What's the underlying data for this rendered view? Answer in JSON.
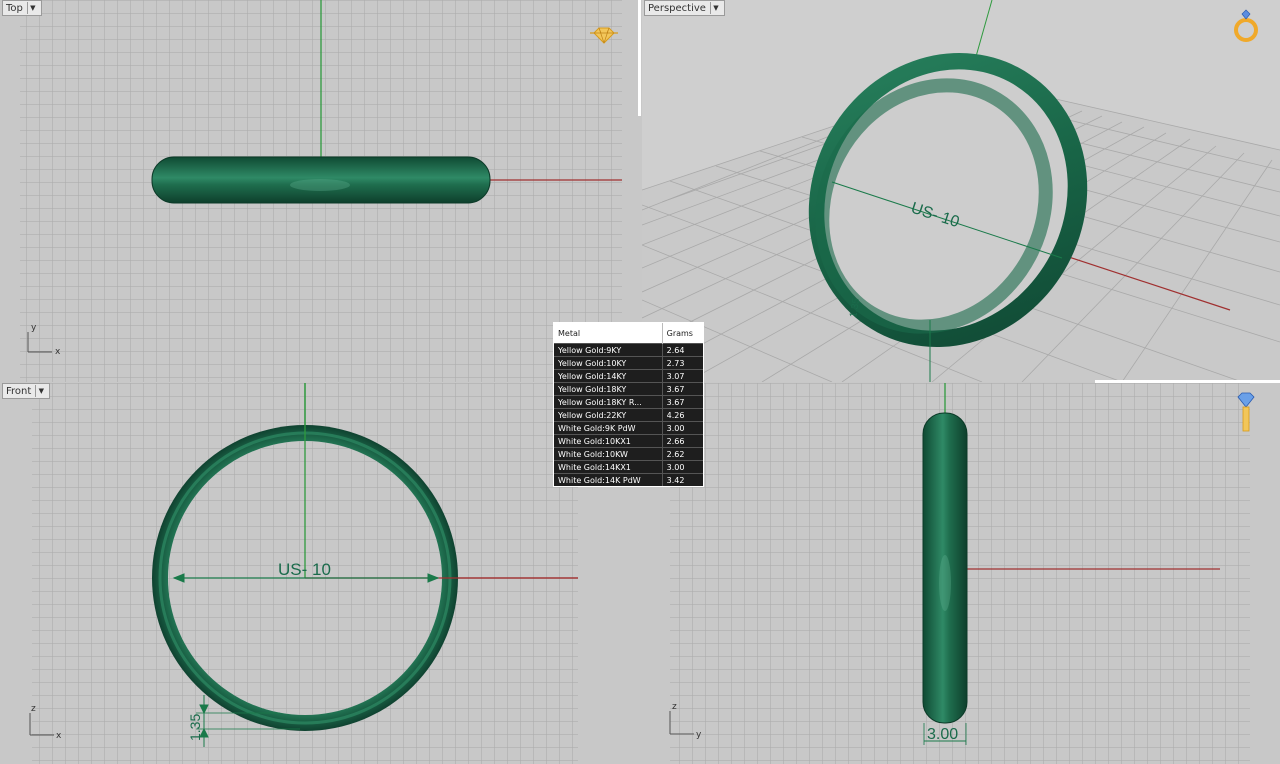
{
  "viewports": {
    "top": {
      "label": "Top",
      "axis_x": "x",
      "axis_y": "y"
    },
    "perspective": {
      "label": "Perspective",
      "dim_text": "US- 10",
      "small_dim": "1.35"
    },
    "front": {
      "label": "Front",
      "dim_text": "US- 10",
      "thickness": "1.35",
      "axis_x": "x",
      "axis_y": "z"
    },
    "right": {
      "label": "",
      "width_dim": "3.00",
      "axis_x": "y",
      "axis_y": "z"
    }
  },
  "icons": {
    "top": "diamond-ring-icon",
    "perspective": "ring-icon",
    "right": "diamond-icon"
  },
  "colors": {
    "ring": "#1e6e4e",
    "x_axis": "#a03030",
    "y_axis": "#2e9a3e",
    "dimension": "#1a7a4a",
    "background": "#c8c8c8",
    "grid": "#a9a9a9"
  },
  "metal_table": {
    "headers": [
      "Metal",
      "Grams"
    ],
    "rows": [
      [
        "Yellow Gold:9KY",
        "2.64"
      ],
      [
        "Yellow Gold:10KY",
        "2.73"
      ],
      [
        "Yellow Gold:14KY",
        "3.07"
      ],
      [
        "Yellow Gold:18KY",
        "3.67"
      ],
      [
        "Yellow Gold:18KY R...",
        "3.67"
      ],
      [
        "Yellow Gold:22KY",
        "4.26"
      ],
      [
        "White Gold:9K PdW",
        "3.00"
      ],
      [
        "White Gold:10KX1",
        "2.66"
      ],
      [
        "White Gold:10KW",
        "2.62"
      ],
      [
        "White Gold:14KX1",
        "3.00"
      ],
      [
        "White Gold:14K PdW",
        "3.42"
      ]
    ]
  }
}
